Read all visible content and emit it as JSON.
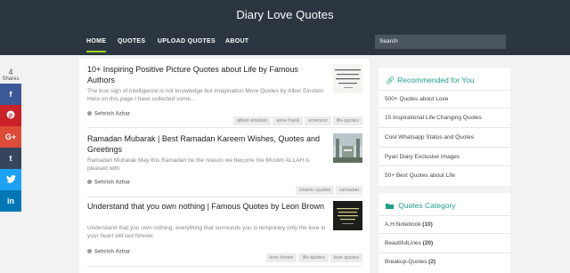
{
  "site": {
    "title": "Diary Love Quotes"
  },
  "nav": {
    "items": [
      "HOME",
      "QUOTES",
      "UPLOAD QUOTES",
      "ABOUT"
    ],
    "search_placeholder": "Search"
  },
  "share": {
    "count": "4",
    "label": "Shares",
    "buttons": [
      {
        "name": "facebook",
        "glyph": "f",
        "color": "#3b5998"
      },
      {
        "name": "pinterest",
        "glyph": "P",
        "color": "#cb2027"
      },
      {
        "name": "google-plus",
        "glyph": "G+",
        "color": "#dd4b39"
      },
      {
        "name": "tumblr",
        "glyph": "t",
        "color": "#35465c"
      },
      {
        "name": "twitter",
        "glyph": "t",
        "color": "#1da1f2"
      },
      {
        "name": "linkedin",
        "glyph": "in",
        "color": "#0077b5"
      }
    ]
  },
  "posts": [
    {
      "title": "10+ Inspiring Positive Picture Quotes about Life by Famous Authors",
      "excerpt": "The true sign of intelligence is not knowledge but imagination More Quotes by Alber Einstein Here on this page I have collected some...",
      "author": "Sehrish Azhar",
      "tags": [
        "albert einstein",
        "anne frank",
        "emerson",
        "life-quotes"
      ]
    },
    {
      "title": "Ramadan Mubarak | Best Ramadan Kareem Wishes, Quotes and Greetings",
      "excerpt": "Ramadan Mubarak May this Ramadan be the reason we become the Muslim ALLAH is pleased with",
      "author": "Sehrish Azhar",
      "tags": [
        "islamic-quotes",
        "ramadan"
      ]
    },
    {
      "title": "Understand that you own nothing | Famous Quotes by Leon Brown",
      "excerpt": "Understand that you own nothing; everything that surrounds you is temporary only the love in your heart will last forever.",
      "author": "Sehrish Azhar",
      "tags": [
        "leon brown",
        "life-quotes",
        "love quotes"
      ]
    }
  ],
  "recommended": {
    "title": "Recommended for You",
    "items": [
      "500+ Quotes about Love",
      "15 Inspirational Life Changing Quotes",
      "Cool Whatsapp Status and Quotes",
      "Pyari Diary Exclusive Images",
      "50+ Best Quotes about Life"
    ]
  },
  "categories": {
    "title": "Quotes Category",
    "items": [
      {
        "name": "A.H.Notebook",
        "count": "(10)"
      },
      {
        "name": "BeautifulLines",
        "count": "(20)"
      },
      {
        "name": "Breakup-Quotes",
        "count": "(2)"
      }
    ]
  },
  "colors": {
    "header_bg": "#2b3640",
    "nav_active_underline": "#9bd41c",
    "widget_title": "#1f9c8a"
  }
}
